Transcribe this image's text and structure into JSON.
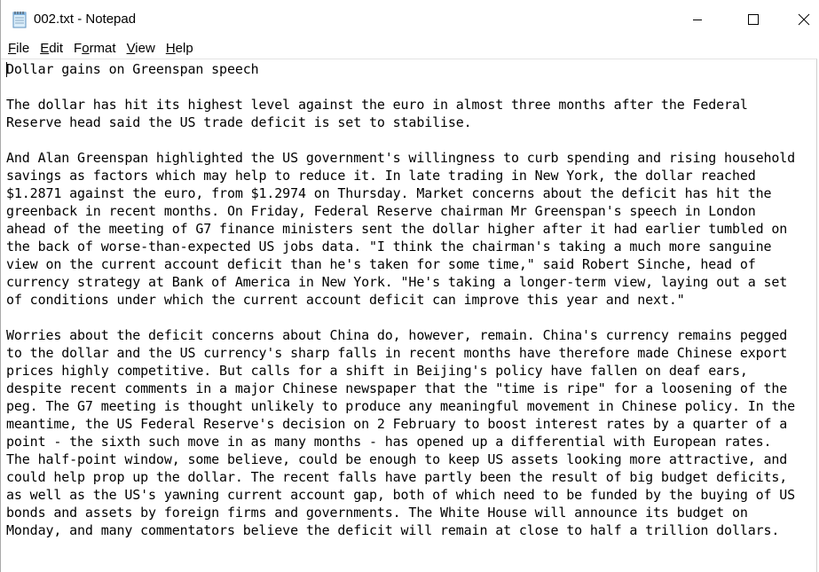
{
  "window": {
    "title": "002.txt - Notepad",
    "icon": "notepad-icon"
  },
  "caption_buttons": {
    "minimize": "minimize-icon",
    "maximize": "maximize-icon",
    "close": "close-icon"
  },
  "menu": {
    "items": [
      {
        "accel": "F",
        "rest": "ile"
      },
      {
        "accel": "E",
        "rest": "dit"
      },
      {
        "pre": "F",
        "accel": "o",
        "rest": "rmat"
      },
      {
        "accel": "V",
        "rest": "iew"
      },
      {
        "accel": "H",
        "rest": "elp"
      }
    ]
  },
  "document": {
    "lines": [
      "Dollar gains on Greenspan speech",
      "",
      "The dollar has hit its highest level against the euro in almost three months after the Federal",
      "Reserve head said the US trade deficit is set to stabilise.",
      "",
      "And Alan Greenspan highlighted the US government's willingness to curb spending and rising household",
      "savings as factors which may help to reduce it. In late trading in New York, the dollar reached",
      "$1.2871 against the euro, from $1.2974 on Thursday. Market concerns about the deficit has hit the",
      "greenback in recent months. On Friday, Federal Reserve chairman Mr Greenspan's speech in London",
      "ahead of the meeting of G7 finance ministers sent the dollar higher after it had earlier tumbled on",
      "the back of worse-than-expected US jobs data. \"I think the chairman's taking a much more sanguine",
      "view on the current account deficit than he's taken for some time,\" said Robert Sinche, head of",
      "currency strategy at Bank of America in New York. \"He's taking a longer-term view, laying out a set",
      "of conditions under which the current account deficit can improve this year and next.\"",
      "",
      "Worries about the deficit concerns about China do, however, remain. China's currency remains pegged",
      "to the dollar and the US currency's sharp falls in recent months have therefore made Chinese export",
      "prices highly competitive. But calls for a shift in Beijing's policy have fallen on deaf ears,",
      "despite recent comments in a major Chinese newspaper that the \"time is ripe\" for a loosening of the",
      "peg. The G7 meeting is thought unlikely to produce any meaningful movement in Chinese policy. In the",
      "meantime, the US Federal Reserve's decision on 2 February to boost interest rates by a quarter of a",
      "point - the sixth such move in as many months - has opened up a differential with European rates.",
      "The half-point window, some believe, could be enough to keep US assets looking more attractive, and",
      "could help prop up the dollar. The recent falls have partly been the result of big budget deficits,",
      "as well as the US's yawning current account gap, both of which need to be funded by the buying of US",
      "bonds and assets by foreign firms and governments. The White House will announce its budget on",
      "Monday, and many commentators believe the deficit will remain at close to half a trillion dollars."
    ]
  }
}
